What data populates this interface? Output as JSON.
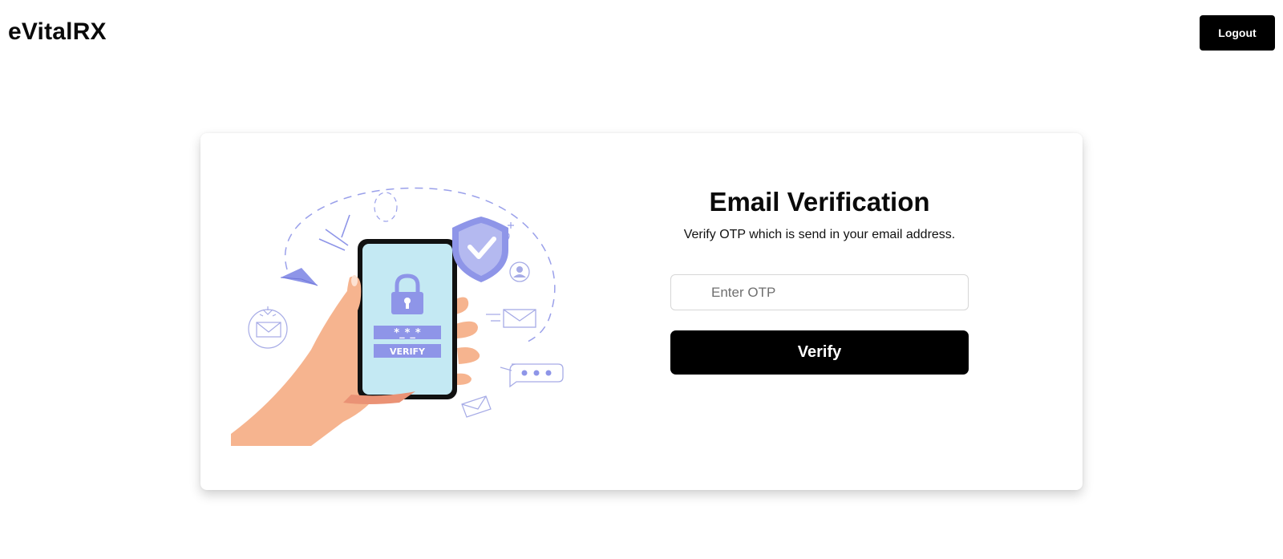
{
  "header": {
    "brand": "eVitalRX",
    "logout_label": "Logout"
  },
  "card": {
    "title": "Email Verification",
    "subtitle": "Verify OTP which is send in your email address.",
    "otp_placeholder": "Enter OTP",
    "otp_value": "",
    "verify_label": "Verify"
  },
  "illustration": {
    "phone_code_text": "*_*_*",
    "phone_button_text": "VERIFY",
    "icons": [
      "hand-phone-icon",
      "lock-icon",
      "shield-check-icon",
      "paper-plane-icon",
      "envelope-icon",
      "user-icon",
      "chat-bubble-icon"
    ]
  },
  "colors": {
    "accent": "#000000",
    "illustration_purple": "#8e95e8",
    "phone_screen": "#c4e9f3",
    "skin": "#f6b48f"
  }
}
